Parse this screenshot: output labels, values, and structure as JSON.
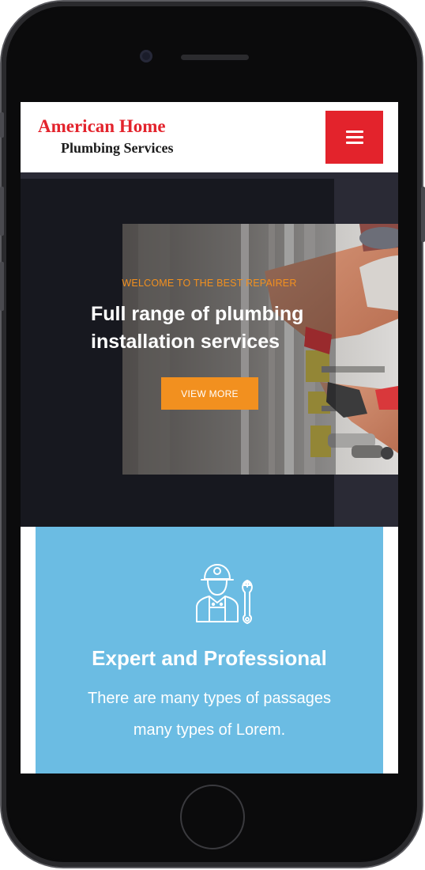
{
  "brand": {
    "line1": "American Home",
    "line2": "Plumbing Services"
  },
  "nav": {
    "menu_icon": "hamburger-icon"
  },
  "hero": {
    "subtitle": "WELCOME TO THE BEST REPAIRER",
    "title_line1": "Full range of plumbing",
    "title_line2": "installation services",
    "cta_label": "VIEW MORE"
  },
  "feature": {
    "icon": "plumber-with-wrench-icon",
    "title": "Expert and Professional",
    "text_line1": "There are many types of passages",
    "text_line2": "many types of Lorem."
  },
  "colors": {
    "brand_red": "#e3232c",
    "accent_orange": "#f2901f",
    "card_blue": "#6bbce3",
    "hero_dark": "#17181f"
  }
}
